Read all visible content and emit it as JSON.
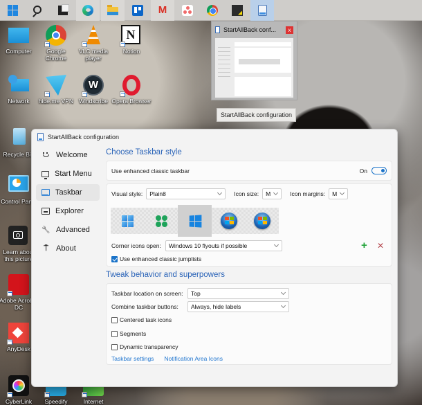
{
  "taskbar": {
    "items": [
      {
        "name": "start-button",
        "label": "Start"
      },
      {
        "name": "search-button",
        "label": "Search"
      },
      {
        "name": "task-view-button",
        "label": "Task View"
      },
      {
        "name": "edge-button",
        "label": "Microsoft Edge"
      },
      {
        "name": "file-explorer-button",
        "label": "File Explorer"
      },
      {
        "name": "trello-button",
        "label": "Trello"
      },
      {
        "name": "gmail-button",
        "label": "Gmail"
      },
      {
        "name": "asana-button",
        "label": "Asana"
      },
      {
        "name": "chrome-button",
        "label": "Google Chrome"
      },
      {
        "name": "sticky-notes-button",
        "label": "Sticky Notes"
      },
      {
        "name": "startallback-button",
        "label": "StartAllBack configuration"
      }
    ],
    "gmail_glyph": "M"
  },
  "thumbnail": {
    "title": "StartAllBack conf...",
    "close_glyph": "x",
    "tooltip": "StartAllBack configuration"
  },
  "desktop": {
    "icons": [
      {
        "label": "Computer"
      },
      {
        "label": "Google Chrome"
      },
      {
        "label": "VLC media player"
      },
      {
        "label": "Notion"
      },
      {
        "label": "Network"
      },
      {
        "label": "hide.me VPN"
      },
      {
        "label": "Windscribe"
      },
      {
        "label": "Opera Browser"
      },
      {
        "label": "Recycle Bin"
      },
      {
        "label": "Control Panel"
      },
      {
        "label": "Learn about this picture"
      },
      {
        "label": "Adobe Acrobat DC"
      },
      {
        "label": "AnyDesk"
      },
      {
        "label": "CyberLink"
      },
      {
        "label": "Speedify"
      },
      {
        "label": "Internet"
      }
    ],
    "notion_glyph": "N",
    "windscribe_glyph": "W"
  },
  "window": {
    "title": "StartAllBack configuration",
    "nav": [
      {
        "label": "Welcome",
        "icon": "smile-icon"
      },
      {
        "label": "Start Menu",
        "icon": "monitor-icon"
      },
      {
        "label": "Taskbar",
        "icon": "taskbar-icon",
        "active": true
      },
      {
        "label": "Explorer",
        "icon": "explorer-icon"
      },
      {
        "label": "Advanced",
        "icon": "wrench-icon"
      },
      {
        "label": "About",
        "icon": "info-icon"
      }
    ],
    "nav_glyphs": {
      "wrench": "🔧",
      "about": "⍑"
    },
    "style_section": {
      "title": "Choose Taskbar style",
      "enhanced_label": "Use enhanced classic taskbar",
      "toggle_state": "On",
      "visual_style_label": "Visual style:",
      "visual_style_value": "Plain8",
      "icon_size_label": "Icon size:",
      "icon_size_value": "M",
      "icon_margins_label": "Icon margins:",
      "icon_margins_value": "M",
      "styles": [
        "Windows 11",
        "Clover",
        "Windows 10",
        "Windows 7",
        "Windows Vista"
      ],
      "selected_style": "Windows 10",
      "corner_label": "Corner icons open:",
      "corner_value": "Windows 10 flyouts if possible",
      "add_glyph": "+",
      "remove_glyph": "✕",
      "jumplists_label": "Use enhanced classic jumplists",
      "jumplists_checked": true,
      "colors": {
        "accent": "#1a73c9",
        "add": "#22a33a",
        "remove": "#b5484f",
        "heading": "#2b64b8"
      }
    },
    "tweak_section": {
      "title": "Tweak behavior and superpowers",
      "location_label": "Taskbar location on screen:",
      "location_value": "Top",
      "combine_label": "Combine taskbar buttons:",
      "combine_value": "Always, hide labels",
      "checkboxes": [
        {
          "label": "Centered task icons",
          "checked": false
        },
        {
          "label": "Segments",
          "checked": false
        },
        {
          "label": "Dynamic transparency",
          "checked": false
        }
      ],
      "links": [
        "Taskbar settings",
        "Notification Area Icons"
      ]
    }
  }
}
